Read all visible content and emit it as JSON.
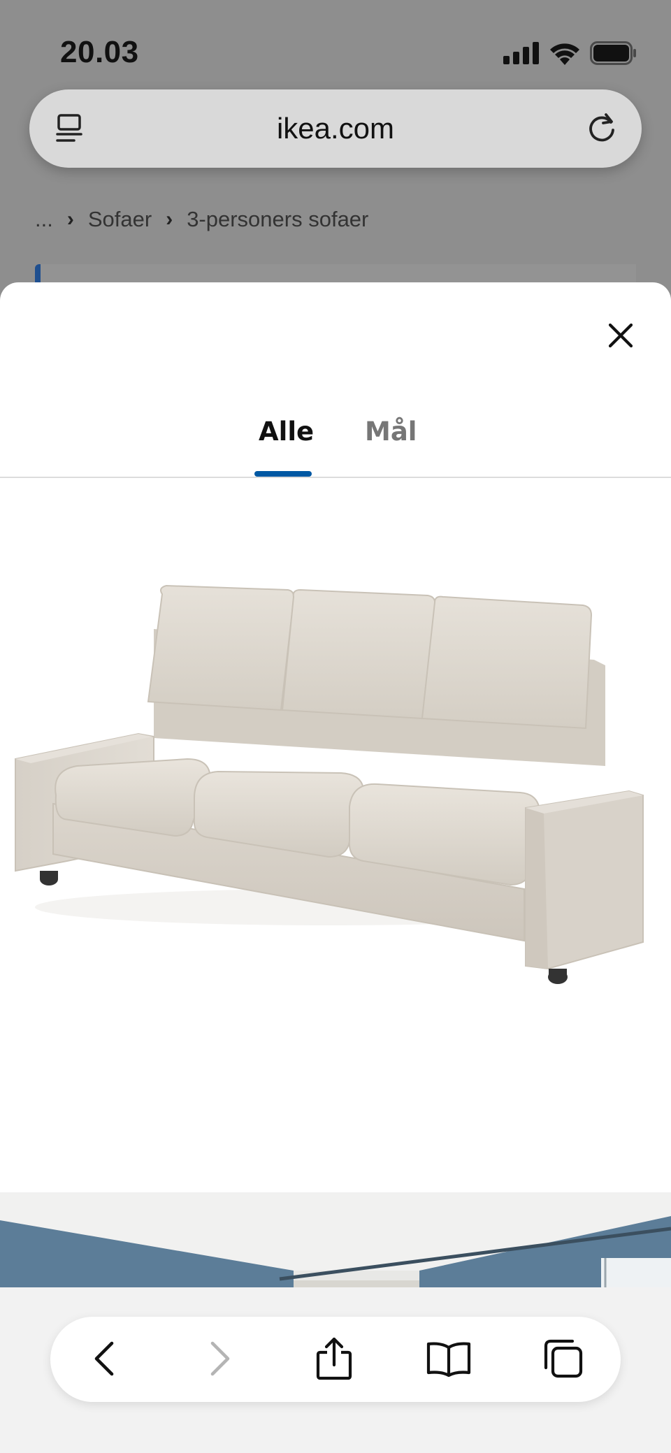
{
  "status_bar": {
    "time": "20.03",
    "icons": [
      "cellular-signal-icon",
      "wifi-icon",
      "battery-icon"
    ]
  },
  "browser": {
    "url": "ikea.com",
    "icons": [
      "reader-mode-icon",
      "reload-icon"
    ]
  },
  "breadcrumb": {
    "items": [
      "...",
      "Sofaer",
      "3-personers sofaer"
    ]
  },
  "sheet": {
    "tabs": [
      {
        "label": "Alle",
        "selected": true
      },
      {
        "label": "Mål",
        "selected": false
      }
    ],
    "close_icon": "close-icon",
    "product_image": "sofa-3-seat-beige"
  },
  "toolbar": {
    "icons": [
      "back-icon",
      "forward-icon",
      "share-icon",
      "bookmarks-icon",
      "tabs-icon"
    ]
  },
  "colors": {
    "accent": "#0058a3",
    "tab_inactive": "#767676",
    "sofa": "#dcd6cd"
  }
}
